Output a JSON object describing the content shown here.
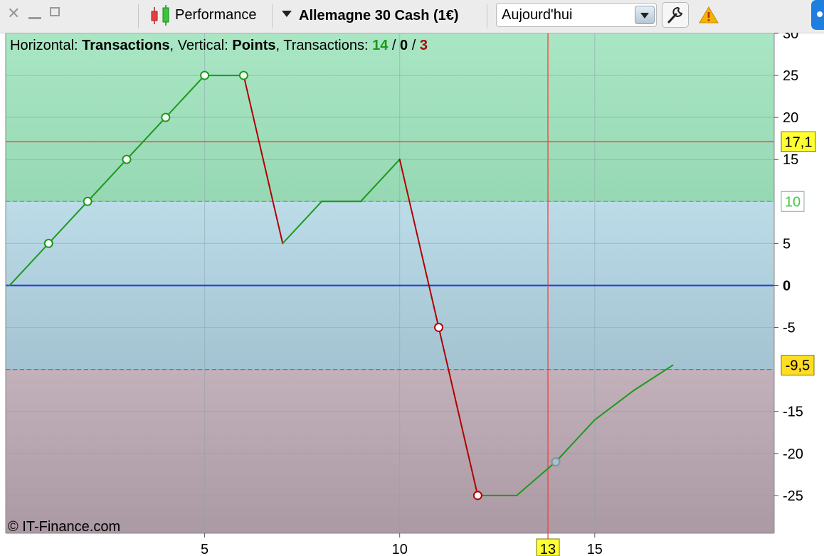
{
  "toolbar": {
    "chart_type_label": "Performance",
    "instrument": "Allemagne 30 Cash (1€)",
    "period": "Aujourd'hui"
  },
  "header": {
    "horizontal_label": "Horizontal: ",
    "horizontal_value": "Transactions",
    "vertical_label": ", Vertical: ",
    "vertical_value": "Points",
    "transactions_label": ", Transactions: ",
    "wins": "14",
    "sep1": " / ",
    "neutral": "0",
    "sep2": " / ",
    "losses": "3"
  },
  "watermark": "© IT-Finance.com",
  "colors": {
    "win": "#1a9a1a",
    "loss": "#b00000",
    "zero_line": "#1f3fd6",
    "crosshair": "#ff3b3b",
    "target_green": "#49c749",
    "highlight": "#ffff00"
  },
  "markers": {
    "crosshair_value": "17,1",
    "target_value": "10",
    "stop_value": "-9,5",
    "crosshair_x": "13"
  },
  "chart_data": {
    "type": "line",
    "x": [
      0,
      1,
      2,
      3,
      4,
      5,
      6,
      7,
      8,
      9,
      10,
      11,
      12,
      13,
      14,
      15,
      16,
      17
    ],
    "y": [
      0,
      5,
      10,
      15,
      20,
      25,
      25,
      5,
      10,
      10,
      15,
      -5,
      -25,
      -25,
      -21,
      -16,
      -12.5,
      -9.5
    ],
    "circle_markers": [
      1,
      2,
      3,
      4,
      5,
      6,
      11,
      12,
      14
    ],
    "xlim": [
      -0.1,
      19.6
    ],
    "ylim": [
      -29.5,
      30
    ],
    "xticks": [
      "5",
      "10",
      "15"
    ],
    "xtick_values": [
      5,
      10,
      15
    ],
    "yticks": [
      "30",
      "25",
      "20",
      "15",
      "5",
      "0",
      "-5",
      "-15",
      "-20",
      "-25"
    ],
    "ytick_values": [
      30,
      25,
      20,
      15,
      5,
      0,
      -5,
      -15,
      -20,
      -25
    ],
    "grid_values": [
      30,
      25,
      20,
      15,
      10,
      5,
      0,
      -5,
      -10,
      -15,
      -20,
      -25
    ],
    "grid_x_values": [
      5,
      10,
      15
    ],
    "zones": {
      "gain_above": 10,
      "loss_below": -10
    },
    "reference_lines": {
      "zero": 0,
      "target": 10,
      "stop": -10,
      "crosshair_y": 17.1,
      "crosshair_x": 13.8
    },
    "grid": true
  }
}
